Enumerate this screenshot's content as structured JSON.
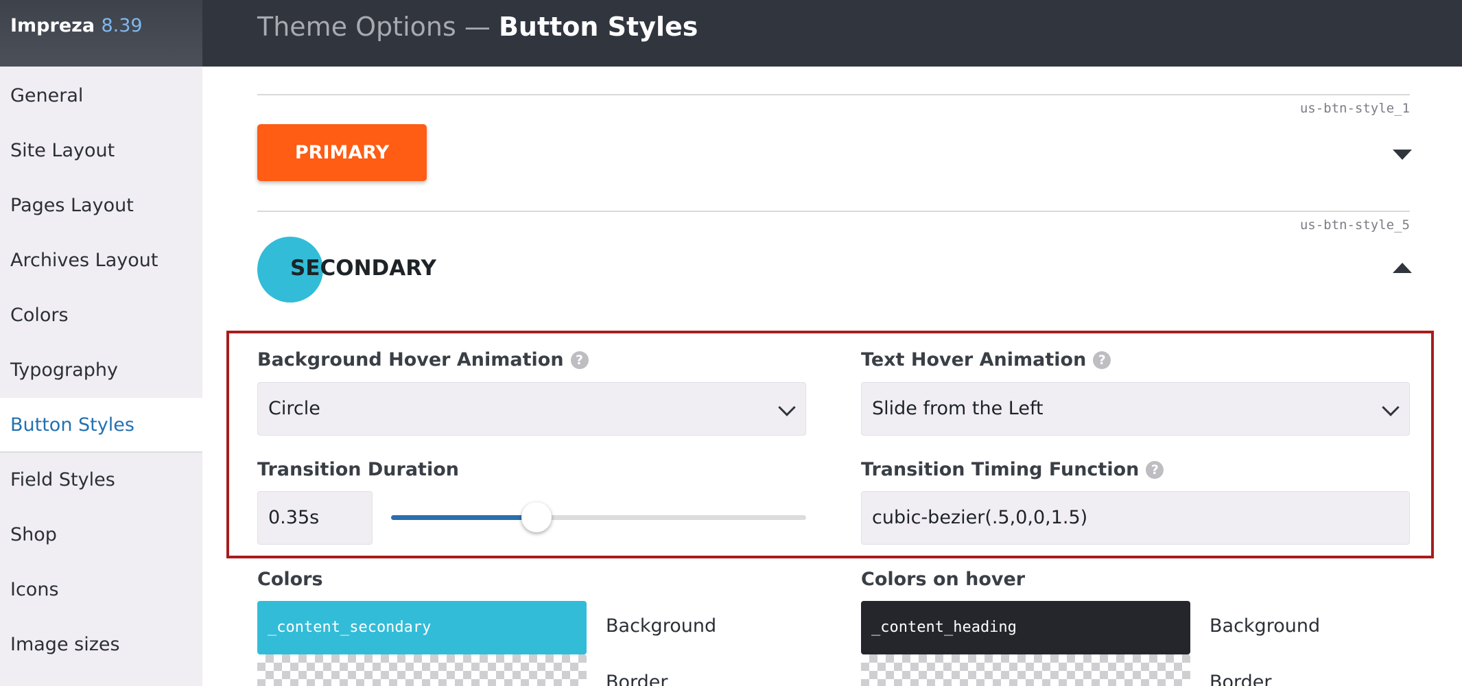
{
  "app": {
    "name": "Impreza",
    "version": "8.39"
  },
  "header": {
    "prefix": "Theme Options — ",
    "title": "Button Styles"
  },
  "sidebar": {
    "items": [
      {
        "label": "General"
      },
      {
        "label": "Site Layout"
      },
      {
        "label": "Pages Layout"
      },
      {
        "label": "Archives Layout"
      },
      {
        "label": "Colors"
      },
      {
        "label": "Typography"
      },
      {
        "label": "Button Styles",
        "active": true
      },
      {
        "label": "Field Styles"
      },
      {
        "label": "Shop"
      },
      {
        "label": "Icons"
      },
      {
        "label": "Image sizes"
      }
    ]
  },
  "styles": {
    "primary": {
      "id": "us-btn-style_1",
      "label": "PRIMARY",
      "expanded": false,
      "color": "#ff5c14"
    },
    "secondary": {
      "id": "us-btn-style_5",
      "label": "SECONDARY",
      "expanded": true,
      "color": "#32bcd8"
    }
  },
  "fields": {
    "bg_hover_animation": {
      "label": "Background Hover Animation",
      "value": "Circle",
      "help_icon": "question-icon"
    },
    "text_hover_animation": {
      "label": "Text Hover Animation",
      "value": "Slide from the Left",
      "help_icon": "question-icon"
    },
    "transition_duration": {
      "label": "Transition Duration",
      "value": "0.35s",
      "slider_fraction": 0.35
    },
    "transition_timing": {
      "label": "Transition Timing Function",
      "value": "cubic-bezier(.5,0,0,1.5)",
      "help_icon": "question-icon"
    }
  },
  "colors": {
    "label": "Colors",
    "background": {
      "value": "_content_secondary",
      "name": "Background",
      "color": "#32bcd8"
    },
    "border": {
      "name": "Border"
    }
  },
  "colors_hover": {
    "label": "Colors on hover",
    "background": {
      "value": "_content_heading",
      "name": "Background",
      "color": "#25262b"
    },
    "border": {
      "name": "Border"
    }
  }
}
